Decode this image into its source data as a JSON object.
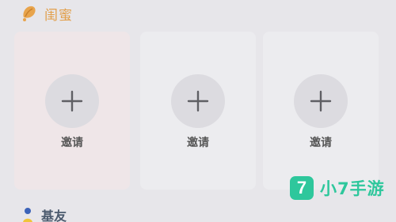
{
  "section_title": "闺蜜",
  "cards": [
    {
      "label": "邀请"
    },
    {
      "label": "邀请"
    },
    {
      "label": "邀请"
    }
  ],
  "friend_section_title": "基友",
  "watermark": {
    "badge": "7",
    "text": "小7手游"
  },
  "colors": {
    "background": "#e7e6ea",
    "accent_orange": "#e2a04d",
    "watermark_green": "#2ec79c"
  },
  "icons": [
    "bestie-icon",
    "plus-icon",
    "friend-icon"
  ]
}
